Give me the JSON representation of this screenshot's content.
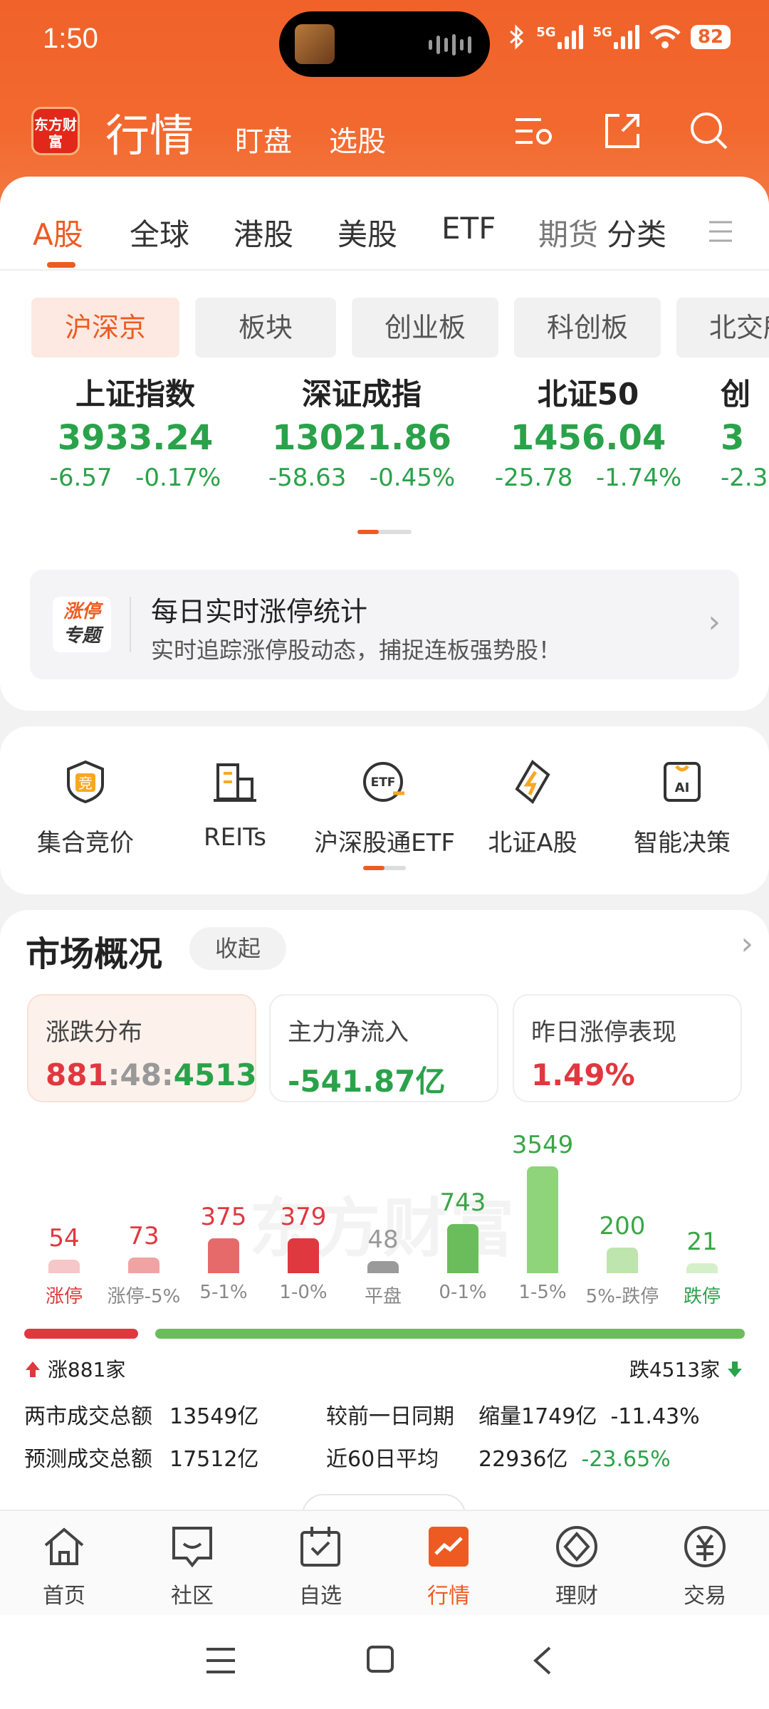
{
  "status_bar": {
    "time": "1:50",
    "net1": "5G",
    "net2": "5G",
    "battery": "82"
  },
  "header": {
    "logo": "东方财富",
    "title": "行情",
    "tab1": "盯盘",
    "tab2": "选股"
  },
  "market_tabs": {
    "items": [
      "A股",
      "全球",
      "港股",
      "美股",
      "ETF",
      "期货",
      "分类"
    ],
    "active": "A股"
  },
  "exchange_chips": [
    "沪深京",
    "板块",
    "创业板",
    "科创板",
    "北交所"
  ],
  "indices": [
    {
      "name": "上证指数",
      "value": "3933.24",
      "change": "-6.57",
      "pct": "-0.17%"
    },
    {
      "name": "深证成指",
      "value": "13021.86",
      "change": "-58.63",
      "pct": "-0.45%"
    },
    {
      "name": "北证50",
      "value": "1456.04",
      "change": "-25.78",
      "pct": "-1.74%"
    },
    {
      "name": "创",
      "value": "3",
      "change": "-2.3",
      "pct": ""
    }
  ],
  "promo": {
    "badge_line1": "涨停",
    "badge_line2": "专题",
    "title": "每日实时涨停统计",
    "subtitle": "实时追踪涨停股动态，捕捉连板强势股！"
  },
  "tools": [
    "集合竞价",
    "REITs",
    "沪深股通ETF",
    "北证A股",
    "智能决策"
  ],
  "market_overview": {
    "title": "市场概况",
    "collapse_label": "收起",
    "boxes": [
      {
        "label": "涨跌分布",
        "up": "881",
        "flat": "48",
        "down": "4513"
      },
      {
        "label": "主力净流入",
        "value": "-541.87亿"
      },
      {
        "label": "昨日涨停表现",
        "value": "1.49%"
      }
    ],
    "watermark": "东方财富",
    "up_label": "涨881家",
    "down_label": "跌4513家",
    "stats": {
      "total_label": "两市成交总额",
      "total_value": "13549亿",
      "compare_label": "较前一日同期",
      "compare_shrink": "缩量1749亿",
      "compare_pct": "-11.43%",
      "forecast_label": "预测成交总额",
      "forecast_value": "17512亿",
      "avg_label": "近60日平均",
      "avg_value": "22936亿",
      "avg_pct": "-23.65%"
    }
  },
  "chart_data": {
    "type": "bar",
    "categories": [
      "涨停",
      "涨停-5%",
      "5-1%",
      "1-0%",
      "平盘",
      "0-1%",
      "1-5%",
      "5%-跌停",
      "跌停"
    ],
    "values": [
      54,
      73,
      375,
      379,
      48,
      743,
      3549,
      200,
      21
    ],
    "colors": [
      "#f5c7c7",
      "#f0a3a3",
      "#e66a6a",
      "#e0383f",
      "#9a9a9a",
      "#6bbd5b",
      "#8fd37b",
      "#bfe5ae",
      "#d5efca"
    ]
  },
  "tabbar": [
    {
      "label": "首页",
      "icon": "home-icon"
    },
    {
      "label": "社区",
      "icon": "community-icon"
    },
    {
      "label": "自选",
      "icon": "watchlist-icon"
    },
    {
      "label": "行情",
      "icon": "market-icon"
    },
    {
      "label": "理财",
      "icon": "finance-icon"
    },
    {
      "label": "交易",
      "icon": "trade-icon"
    }
  ]
}
